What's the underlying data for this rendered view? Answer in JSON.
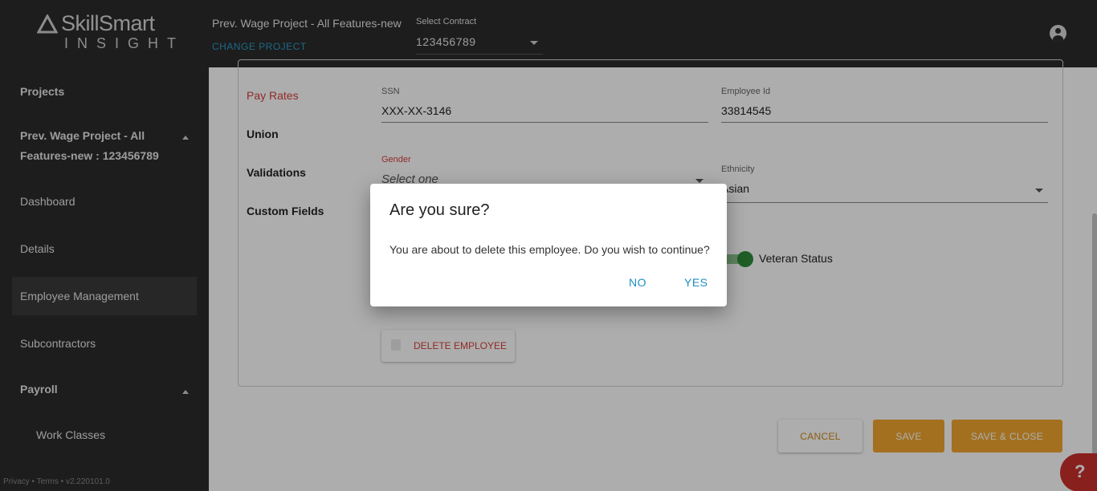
{
  "header": {
    "logo": {
      "brand": "SkillSmart",
      "sub": "INSIGHT"
    },
    "project_name": "Prev. Wage Project - All Features-new",
    "change_project": "CHANGE PROJECT",
    "contract_label": "Select Contract",
    "contract_value": "123456789"
  },
  "sidebar": {
    "projects": "Projects",
    "project_line1": "Prev. Wage Project - All",
    "project_line2": "Features-new : 123456789",
    "dashboard": "Dashboard",
    "details": "Details",
    "employee_management": "Employee Management",
    "subcontractors": "Subcontractors",
    "payroll": "Payroll",
    "work_classes": "Work Classes",
    "footer": "Privacy • Terms • v2.220101.0"
  },
  "form": {
    "tabs": {
      "pay_rates": "Pay Rates",
      "union": "Union",
      "validations": "Validations",
      "custom_fields": "Custom Fields"
    },
    "ssn": {
      "label": "SSN",
      "value": "XXX-XX-3146"
    },
    "employee_id": {
      "label": "Employee Id",
      "value": "33814545"
    },
    "gender": {
      "label": "Gender",
      "placeholder": "Select one"
    },
    "ethnicity": {
      "label": "Ethnicity",
      "value": "Asian"
    },
    "veteran_status": {
      "label": "Veteran Status",
      "checked": true
    },
    "delete_employee": "DELETE EMPLOYEE",
    "cancel": "CANCEL",
    "save": "SAVE",
    "save_close": "SAVE & CLOSE"
  },
  "help": {
    "label": "?"
  },
  "dialog": {
    "title": "Are you sure?",
    "message": "You are about to delete this employee. Do you wish to continue?",
    "no": "NO",
    "yes": "YES"
  },
  "colors": {
    "accent_blue": "#1e8ec1",
    "error_red": "#d43f3a",
    "save_orange": "#f1a630",
    "dark_bg": "#2b2b2b"
  }
}
